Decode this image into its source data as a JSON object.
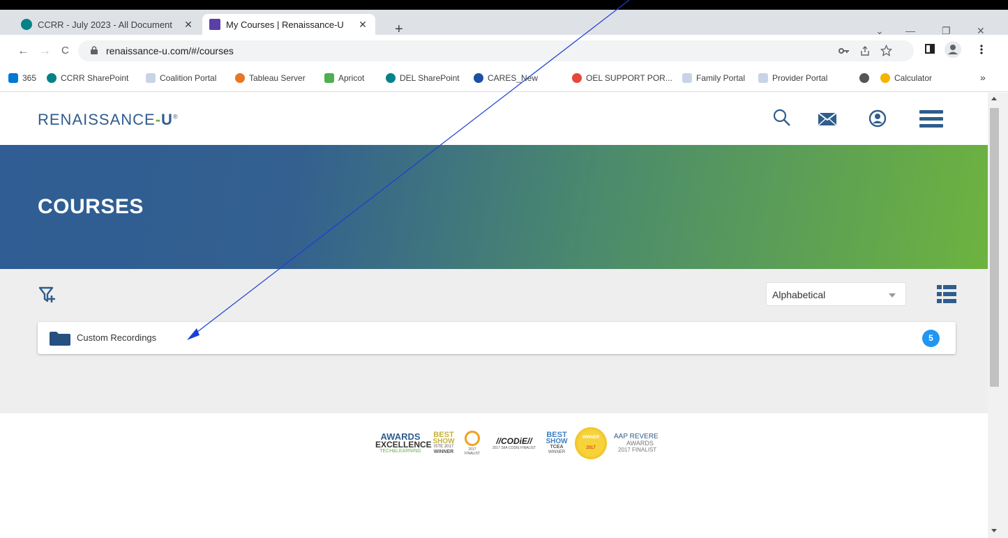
{
  "tabs": [
    {
      "label": "CCRR - July 2023 - All Document",
      "close": "✕",
      "favicon_color": "#038387"
    },
    {
      "label": "My Courses | Renaissance-U",
      "close": "✕",
      "favicon_color": "#5b3fa8"
    }
  ],
  "new_tab": "+",
  "window_controls": {
    "chevron": "⌄",
    "minimize": "—",
    "restore": "❐",
    "close": "✕"
  },
  "nav": {
    "back": "←",
    "forward": "→",
    "reload": "C"
  },
  "address": {
    "url": "renaissance-u.com/#/courses"
  },
  "bookmarks": [
    {
      "label": "365",
      "color": "#0078d4"
    },
    {
      "label": "CCRR SharePoint",
      "color": "#038387"
    },
    {
      "label": "Coalition Portal",
      "color": "#c8d4e6"
    },
    {
      "label": "Tableau Server",
      "color": "#e97627"
    },
    {
      "label": "Apricot",
      "color": "#4caf50"
    },
    {
      "label": "DEL SharePoint",
      "color": "#038387"
    },
    {
      "label": "CARES_New",
      "color": "#1e4fa0"
    },
    {
      "label": "OEL SUPPORT POR...",
      "color": "#e8453c"
    },
    {
      "label": "Family Portal",
      "color": "#c8d4e6"
    },
    {
      "label": "Provider Portal",
      "color": "#c8d4e6"
    },
    {
      "label": "",
      "color": "#555555"
    },
    {
      "label": "Calculator",
      "color": "#f4b400"
    }
  ],
  "bookmarks_more": "»",
  "site": {
    "logo_main": "RENAISSANCE",
    "logo_dash": "-",
    "logo_u": "U",
    "logo_reg": "®"
  },
  "hero": {
    "title": "COURSES"
  },
  "sort": {
    "selected": "Alphabetical"
  },
  "courses": [
    {
      "name": "Custom Recordings",
      "count": "5"
    }
  ],
  "awards": [
    {
      "lines": [
        "AWARDS",
        "EXCELLENCE",
        "TECH&LEARNING"
      ]
    },
    {
      "lines": [
        "BEST",
        "SHOW",
        "ISTE 2017",
        "WINNER"
      ]
    },
    {
      "lines": [
        "2017",
        "FINALIST"
      ]
    },
    {
      "lines": [
        "//CODiE//",
        "2017 SIIA CODIE FINALIST"
      ]
    },
    {
      "lines": [
        "BEST",
        "SHOW",
        "TCEA",
        "WINNER"
      ]
    },
    {
      "lines": [
        "WINNER",
        "2017"
      ]
    },
    {
      "lines": [
        "AAP REVERE",
        "AWARDS",
        "2017 FINALIST"
      ]
    }
  ],
  "colors": {
    "brand_blue": "#2f5d8c",
    "brand_green": "#6ab04c",
    "badge_blue": "#2196f3",
    "annotation_arrow": "#1a3fd6"
  }
}
